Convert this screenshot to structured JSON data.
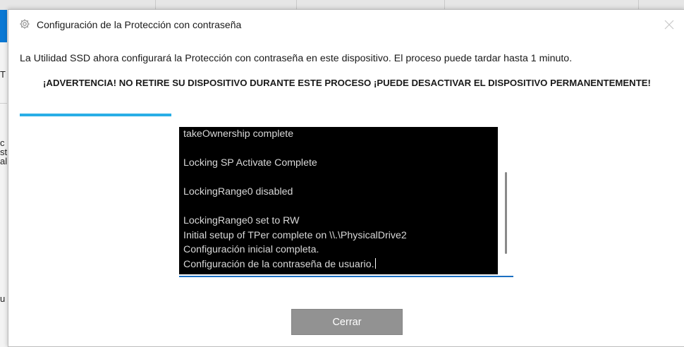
{
  "window": {
    "title": "Configuración de la Protección con contraseña",
    "icon": "gear-icon",
    "close_icon": "close-icon"
  },
  "message": {
    "intro": "La Utilidad SSD ahora configurará la Protección con contraseña en este dispositivo. El proceso puede tardar hasta 1 minuto.",
    "warning": "¡ADVERTENCIA! NO RETIRE SU DISPOSITIVO DURANTE ESTE PROCESO ¡PUEDE DESACTIVAR EL DISPOSITIVO PERMANENTEMENTE!"
  },
  "progress": {
    "fraction": 1.0,
    "color": "#29aee6"
  },
  "log": {
    "lines": [
      "takeOwnership complete",
      "",
      "Locking SP Activate Complete",
      "",
      "LockingRange0 disabled",
      "",
      "LockingRange0 set to RW",
      "Initial setup of TPer complete on \\\\.\\PhysicalDrive2",
      "Configuración inicial completa.",
      "Configuración de la contraseña de usuario."
    ]
  },
  "buttons": {
    "close_label": "Cerrar"
  },
  "background": {
    "fragments": [
      "T",
      "c",
      "st",
      "al",
      "u"
    ],
    "accent_color": "#0a78d4"
  }
}
